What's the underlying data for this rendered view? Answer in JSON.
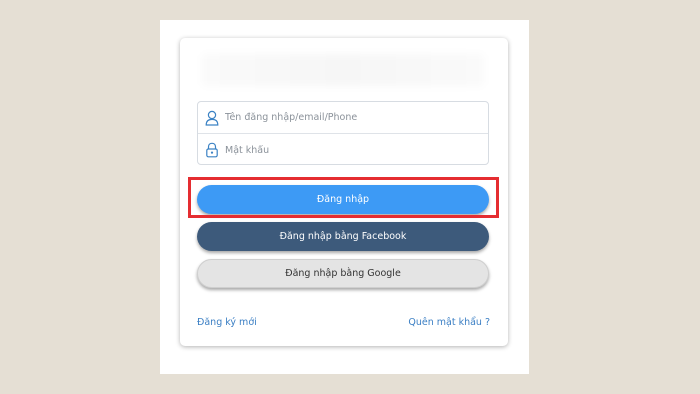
{
  "login_form": {
    "username": {
      "placeholder": "Tên đăng nhập/email/Phone",
      "value": "",
      "icon": "user-icon"
    },
    "password": {
      "placeholder": "Mật khẩu",
      "value": "",
      "icon": "lock-icon"
    },
    "login_button_label": "Đăng nhập",
    "facebook_button_label": "Đăng nhập bằng Facebook",
    "google_button_label": "Đăng nhập bằng Google",
    "register_link": "Đăng ký mới",
    "forgot_password_link": "Quên mật khẩu ?"
  },
  "colors": {
    "background": "#e5dfd4",
    "login_button": "#3d9af5",
    "facebook_button": "#3d5a7b",
    "google_button": "#e4e4e4",
    "highlight_border": "#e52d31",
    "link": "#3b7fc4"
  }
}
